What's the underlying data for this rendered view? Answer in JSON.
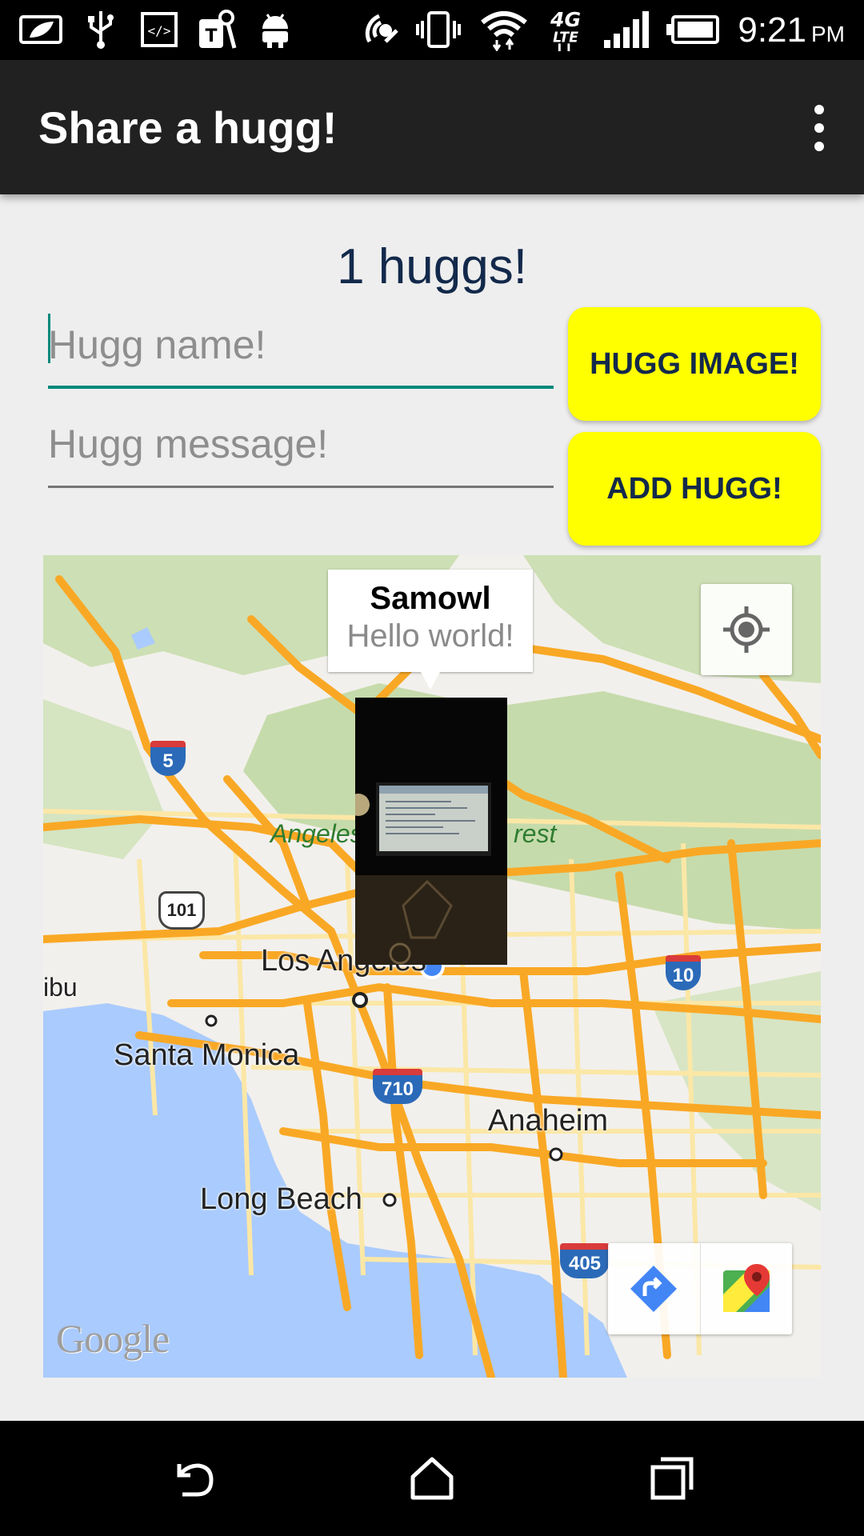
{
  "status_bar": {
    "time": "9:21",
    "ampm": "PM",
    "network": "4G LTE"
  },
  "app_bar": {
    "title": "Share a hugg!",
    "overflow_icon": "more-vert-icon"
  },
  "main": {
    "counter": "1 huggs!",
    "name_field": {
      "placeholder": "Hugg name!",
      "value": ""
    },
    "message_field": {
      "placeholder": "Hugg message!",
      "value": ""
    },
    "hugg_image_button": "HUGG IMAGE!",
    "add_hugg_button": "ADD HUGG!"
  },
  "map": {
    "info_window": {
      "title": "Samowl",
      "message": "Hello world!"
    },
    "labels": {
      "los_angeles": "Los Angeles",
      "santa_monica": "Santa Monica",
      "anaheim": "Anaheim",
      "long_beach": "Long Beach",
      "malibu": "ibu",
      "forest_left": "Angeles",
      "forest_right": "rest"
    },
    "shields": {
      "i5": "5",
      "us101": "101",
      "i10": "10",
      "i710": "710",
      "i405": "405"
    },
    "attribution": "Google",
    "colors": {
      "water": "#aacbff",
      "highway": "#f9a825",
      "park": "#c8dcae",
      "button_yellow": "#ffff00",
      "accent": "#00897b"
    }
  },
  "nav_bar": {
    "back": "back-icon",
    "home": "home-icon",
    "recents": "recents-icon"
  }
}
